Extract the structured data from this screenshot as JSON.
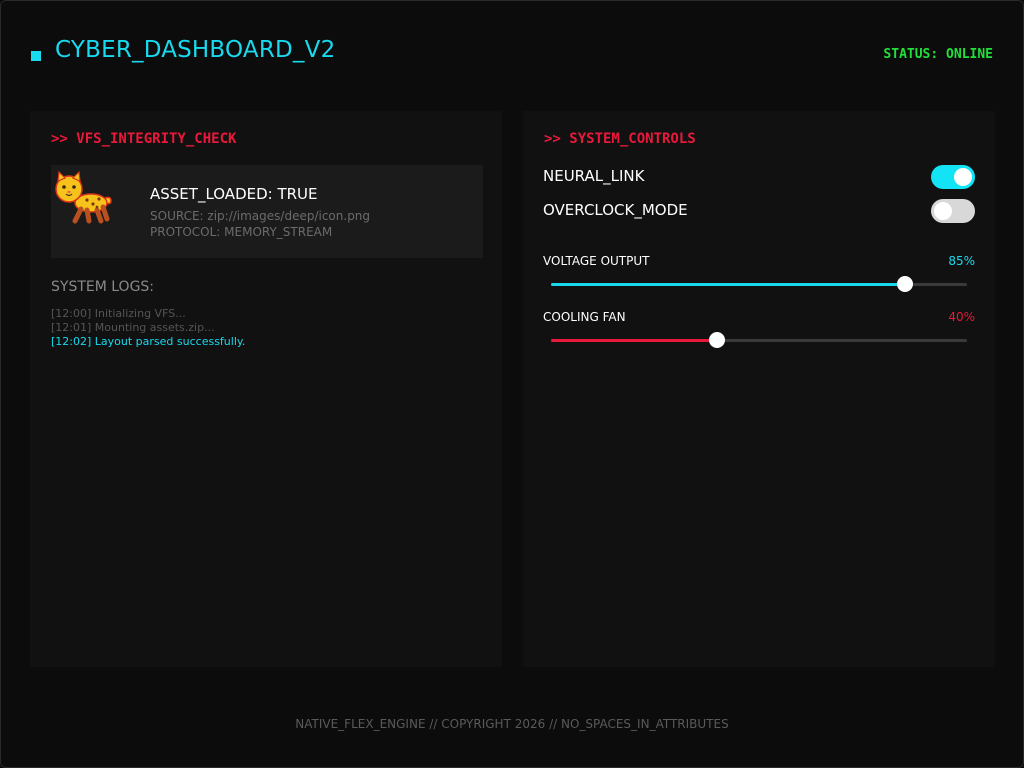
{
  "header": {
    "title": "CYBER_DASHBOARD_V2",
    "status": "STATUS: ONLINE",
    "accent_color": "#19d9ee",
    "status_color": "#21e03a"
  },
  "vfs_panel": {
    "heading": ">> VFS_INTEGRITY_CHECK",
    "asset": {
      "icon": "leopard-icon",
      "title": "ASSET_LOADED: TRUE",
      "source": "SOURCE: zip://images/deep/icon.png",
      "protocol": "PROTOCOL: MEMORY_STREAM"
    },
    "logs_title": "SYSTEM LOGS:",
    "logs": [
      "[12:00] Initializing VFS...",
      "[12:01] Mounting assets.zip...",
      "[12:02] Layout parsed successfully."
    ]
  },
  "controls_panel": {
    "heading": ">> SYSTEM_CONTROLS",
    "toggles": [
      {
        "label": "NEURAL_LINK",
        "on": true
      },
      {
        "label": "OVERCLOCK_MODE",
        "on": false
      }
    ],
    "sliders": [
      {
        "label": "VOLTAGE OUTPUT",
        "value_text": "85%",
        "value": 85,
        "color": "#19d9ee"
      },
      {
        "label": "COOLING FAN",
        "value_text": "40%",
        "value": 40,
        "color": "#e8193a"
      }
    ]
  },
  "footer": {
    "text": "NATIVE_FLEX_ENGINE // COPYRIGHT 2026 // NO_SPACES_IN_ATTRIBUTES"
  }
}
